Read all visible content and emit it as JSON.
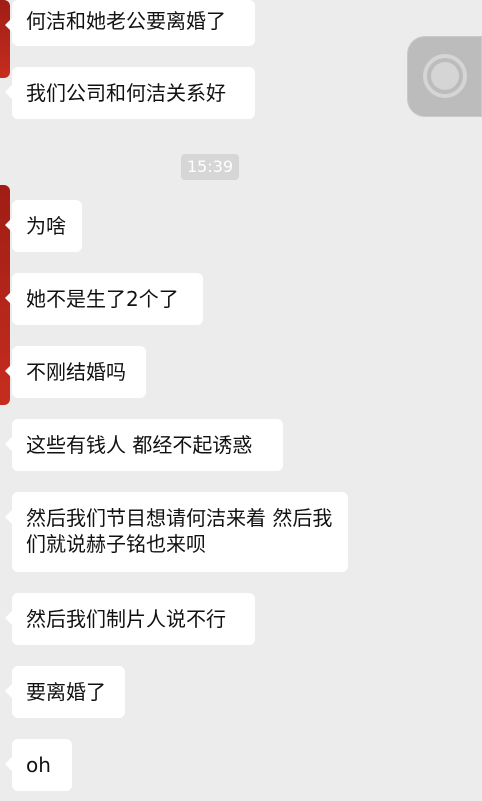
{
  "time_badge": "15:39",
  "messages": [
    {
      "text": "何洁和她老公要离婚了"
    },
    {
      "text": "我们公司和何洁关系好"
    },
    {
      "text": "为啥"
    },
    {
      "text": "她不是生了2个了"
    },
    {
      "text": "不刚结婚吗"
    },
    {
      "text": "这些有钱人 都经不起诱惑"
    },
    {
      "text": "然后我们节目想请何洁来着 然后我们就说赫子铭也来呗"
    },
    {
      "text": "然后我们制片人说不行"
    },
    {
      "text": "要离婚了"
    },
    {
      "text": "oh"
    }
  ]
}
